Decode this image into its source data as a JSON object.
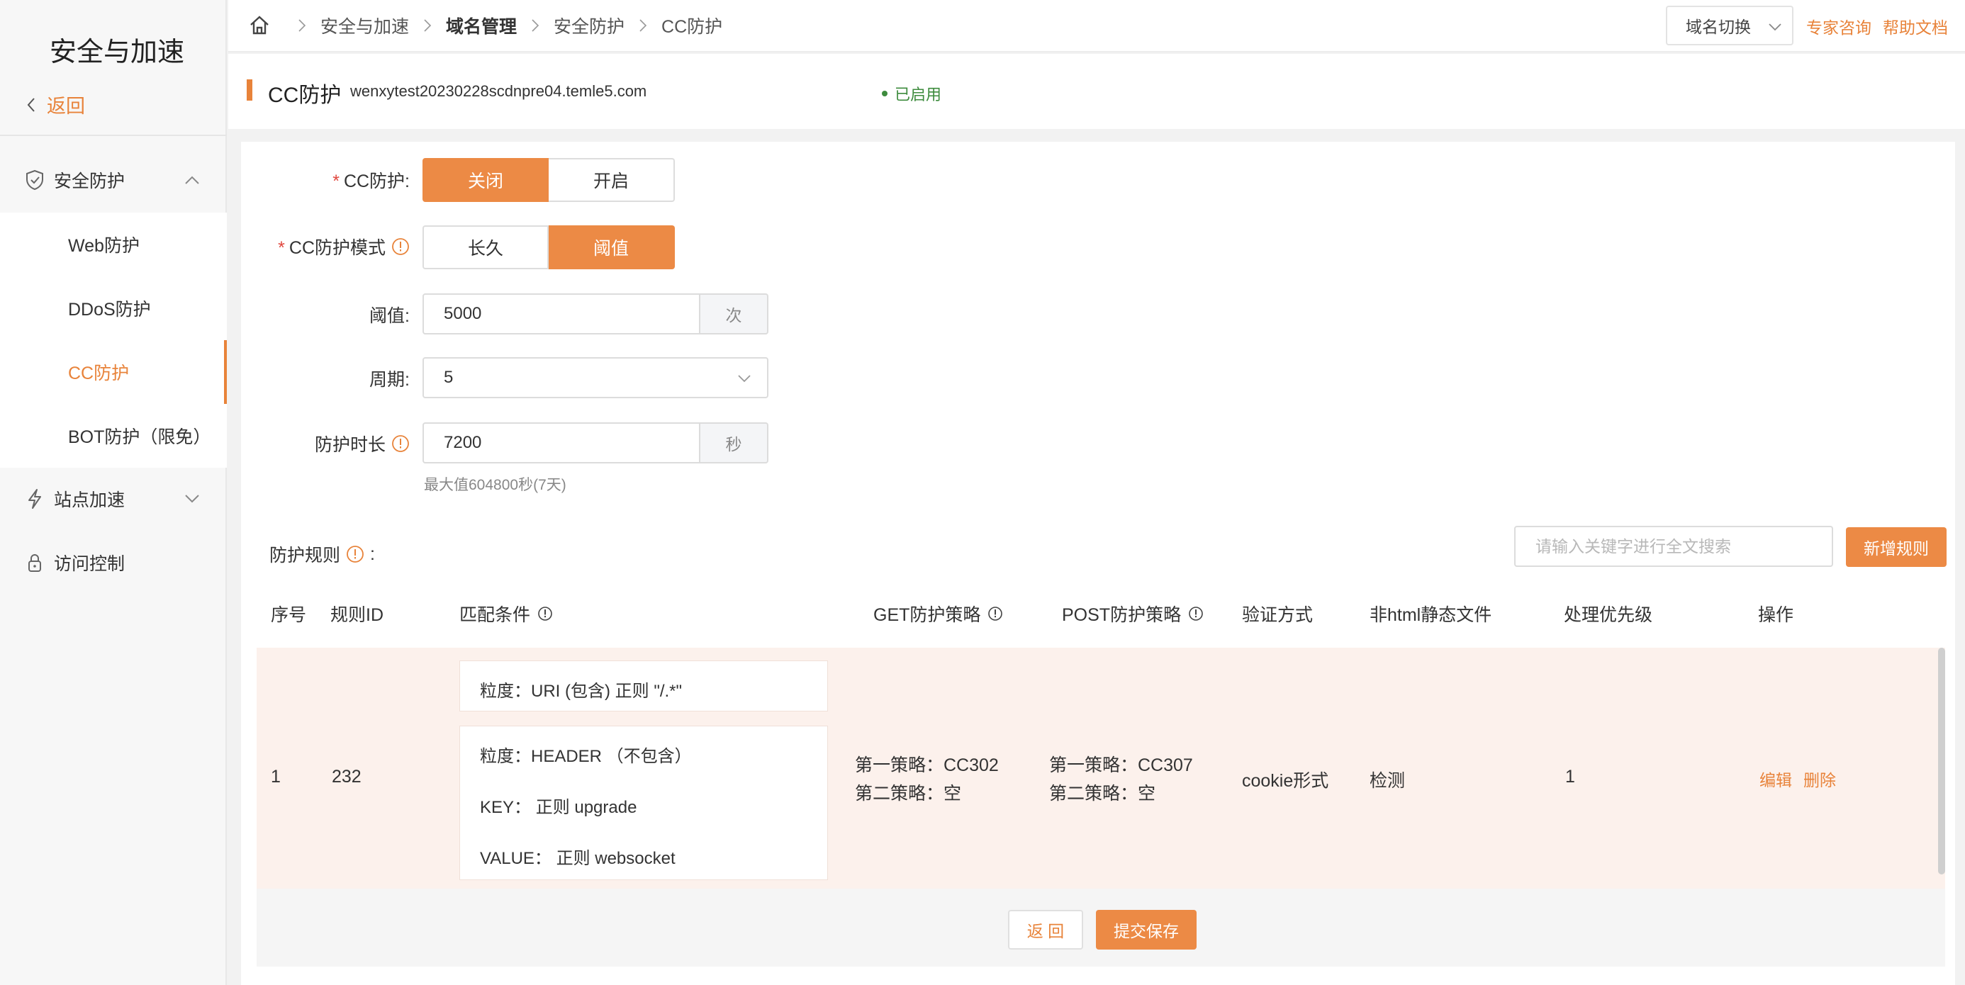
{
  "sidebar": {
    "title": "安全与加速",
    "back_label": "返回",
    "groups": [
      {
        "label": "安全防护",
        "icon": "shield-icon",
        "expanded": true
      },
      {
        "label": "站点加速",
        "icon": "lightning-icon",
        "expanded": false
      },
      {
        "label": "访问控制",
        "icon": "lock-icon",
        "expanded": false
      }
    ],
    "sub_items": [
      "Web防护",
      "DDoS防护",
      "CC防护",
      "BOT防护（限免）"
    ],
    "active_item": "CC防护"
  },
  "breadcrumb": [
    "安全与加速",
    "域名管理",
    "安全防护",
    "CC防护"
  ],
  "topbar": {
    "domain_switch": "域名切换",
    "expert_link": "专家咨询",
    "help_link": "帮助文档"
  },
  "header": {
    "title": "CC防护",
    "domain": "wenxytest20230228scdnpre04.temle5.com",
    "status": "已启用"
  },
  "form": {
    "cc_label": "CC防护:",
    "cc_options": [
      "关闭",
      "开启"
    ],
    "cc_selected": "关闭",
    "mode_label": "CC防护模式",
    "mode_options": [
      "长久",
      "阈值"
    ],
    "mode_selected": "阈值",
    "threshold_label": "阈值:",
    "threshold_value": "5000",
    "threshold_unit": "次",
    "period_label": "周期:",
    "period_value": "5",
    "duration_label": "防护时长",
    "duration_value": "7200",
    "duration_unit": "秒",
    "duration_hint": "最大值604800秒(7天)",
    "rules_label": "防护规则",
    "search_placeholder": "请输入关键字进行全文搜索",
    "add_rule": "新增规则"
  },
  "table": {
    "columns": [
      "序号",
      "规则ID",
      "匹配条件",
      "GET防护策略",
      "POST防护策略",
      "验证方式",
      "非html静态文件",
      "处理优先级",
      "操作"
    ],
    "rows": [
      {
        "index": "1",
        "rule_id": "232",
        "conditions": [
          [
            "粒度：URI (包含) 正则 \"/.*\""
          ],
          [
            "粒度：HEADER （不包含）",
            "KEY：  正则 upgrade",
            "VALUE：  正则 websocket"
          ]
        ],
        "get_policy": [
          "第一策略：CC302",
          "第二策略：空"
        ],
        "post_policy": [
          "第一策略：CC307",
          "第二策略：空"
        ],
        "verify": "cookie形式",
        "static_file": "检测",
        "priority": "1",
        "actions": [
          "编辑",
          "删除"
        ]
      }
    ]
  },
  "footer": {
    "back": "返 回",
    "submit": "提交保存"
  },
  "colors": {
    "accent": "#ec8a45",
    "status_green": "#3d8b3d",
    "row_highlight": "#fcf1ec"
  }
}
